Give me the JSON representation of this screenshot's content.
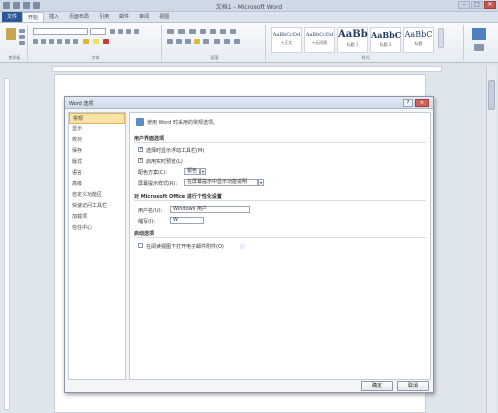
{
  "window": {
    "title": "文档1 - Microsoft Word"
  },
  "tabs": [
    {
      "label": "文件"
    },
    {
      "label": "开始"
    },
    {
      "label": "插入"
    },
    {
      "label": "页面布局"
    },
    {
      "label": "引用"
    },
    {
      "label": "邮件"
    },
    {
      "label": "审阅"
    },
    {
      "label": "视图"
    }
  ],
  "ribbon": {
    "groups": [
      "剪贴板",
      "字体",
      "段落",
      "样式"
    ],
    "styles": [
      {
        "sample": "AaBbCcDd",
        "name": "+正文"
      },
      {
        "sample": "AaBbCcDd",
        "name": "+无间隔"
      },
      {
        "sample": "AaBb",
        "name": "标题 1"
      },
      {
        "sample": "AaBbC",
        "name": "标题 2"
      },
      {
        "sample": "AaBbC",
        "name": "标题"
      }
    ]
  },
  "dialog": {
    "title": "Word 选项",
    "nav": [
      "常规",
      "显示",
      "校对",
      "保存",
      "版式",
      "语言",
      "高级",
      "自定义功能区",
      "快速访问工具栏",
      "加载项",
      "信任中心"
    ],
    "header": "使用 Word 时采用的常规选项。",
    "sections": {
      "ui": "用户界面选项",
      "personalize": "对 Microsoft Office 进行个性化设置",
      "startup": "启动选项"
    },
    "options": {
      "mini_toolbar": "选择时显示浮动工具栏(M)",
      "live_preview": "启用实时预览(L)",
      "color_scheme_label": "配色方案(C):",
      "color_scheme_value": "银色",
      "tooltip_label": "屏幕提示样式(R):",
      "tooltip_value": "在屏幕提示中显示功能说明"
    },
    "personal": {
      "username_label": "用户名(U):",
      "username_value": "Windows 用户",
      "initials_label": "缩写(I):",
      "initials_value": "W"
    },
    "startup": {
      "email_attach": "在阅读视图下打开电子邮件附件(O)"
    },
    "buttons": {
      "ok": "确定",
      "cancel": "取消"
    }
  }
}
